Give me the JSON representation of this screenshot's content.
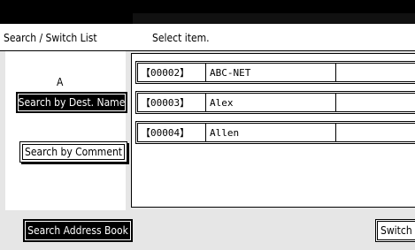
{
  "header": {
    "panel_title": "Search / Switch List",
    "instruction": "Select item."
  },
  "left_panel": {
    "index_letter": "A",
    "search_by_name_label": "Search by Dest. Name",
    "search_by_comment_label": "Search by Comment"
  },
  "list": {
    "rows": [
      {
        "id": "【00002】",
        "name": "ABC-NET"
      },
      {
        "id": "【00003】",
        "name": "Alex"
      },
      {
        "id": "【00004】",
        "name": "Allen"
      }
    ]
  },
  "footer": {
    "search_address_book_label": "Search Address Book",
    "switch_label": "Switch"
  }
}
